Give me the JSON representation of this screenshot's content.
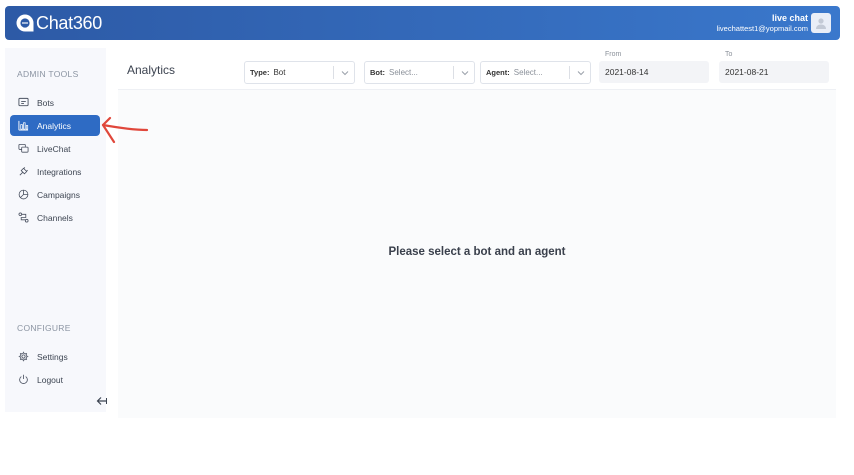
{
  "app": {
    "logo_text": "Chat360"
  },
  "header": {
    "user_name": "live chat",
    "user_email": "livechattest1@yopmail.com"
  },
  "sidebar": {
    "admin_label": "ADMIN TOOLS",
    "items": [
      {
        "label": "Bots",
        "icon": "bot-icon"
      },
      {
        "label": "Analytics",
        "icon": "bar-chart-icon",
        "active": true
      },
      {
        "label": "LiveChat",
        "icon": "chat-icon"
      },
      {
        "label": "Integrations",
        "icon": "plug-icon"
      },
      {
        "label": "Campaigns",
        "icon": "pie-chart-icon"
      },
      {
        "label": "Channels",
        "icon": "channels-icon"
      }
    ],
    "configure_label": "CONFIGURE",
    "config_items": [
      {
        "label": "Settings",
        "icon": "gear-icon"
      },
      {
        "label": "Logout",
        "icon": "power-icon"
      }
    ],
    "collapse_icon": "collapse-arrow-icon"
  },
  "toolbar": {
    "title": "Analytics",
    "type_select": {
      "label": "Type:",
      "value": "Bot"
    },
    "bot_select": {
      "label": "Bot:",
      "placeholder": "Select..."
    },
    "agent_select": {
      "label": "Agent:",
      "placeholder": "Select..."
    },
    "from": {
      "label": "From",
      "value": "2021-08-14"
    },
    "to": {
      "label": "To",
      "value": "2021-08-21"
    }
  },
  "main": {
    "empty_message": "Please select a bot and an agent"
  },
  "annotation": {
    "color": "#e0473b"
  },
  "colors": {
    "header_start": "#2d5aa6",
    "header_end": "#3a78cc",
    "accent": "#2e6bc4"
  }
}
